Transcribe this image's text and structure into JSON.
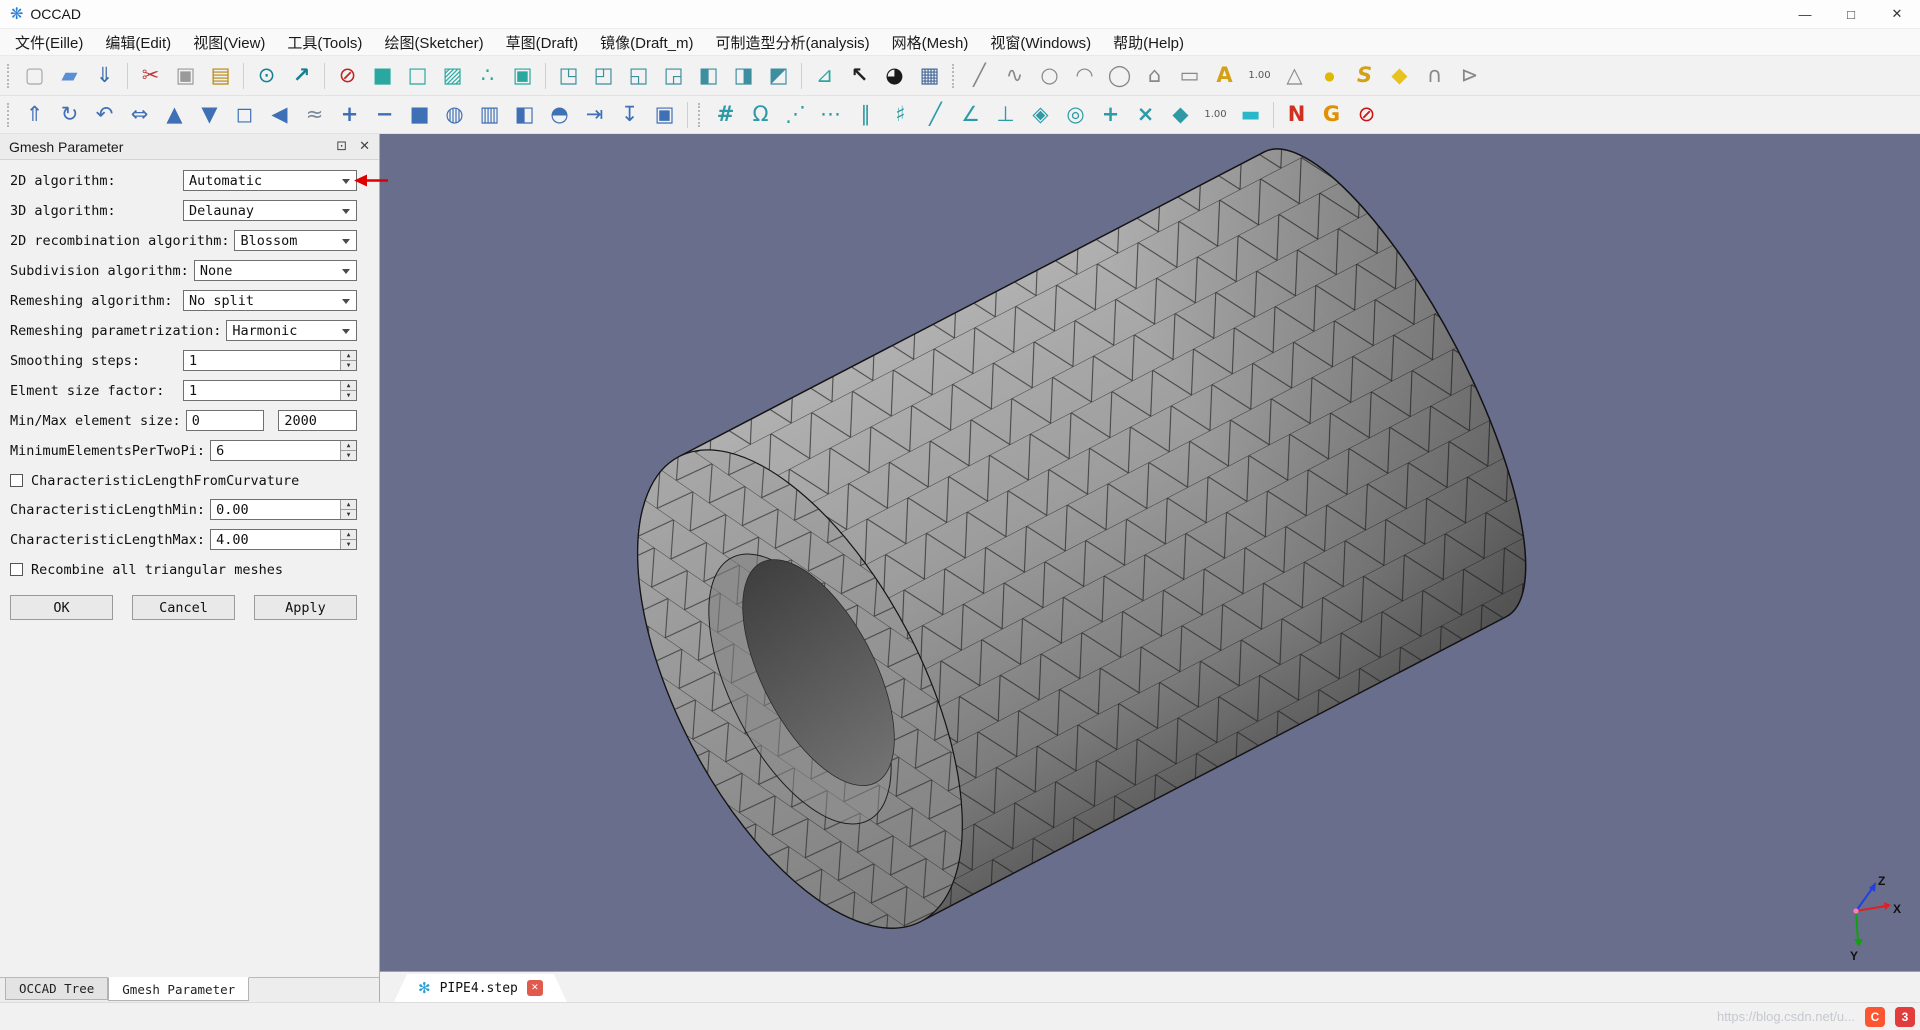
{
  "window": {
    "title": "OCCAD",
    "minimize": "—",
    "maximize": "□",
    "close": "✕"
  },
  "menubar": {
    "items": [
      {
        "name": "menu-file",
        "label": "文件(Eille)"
      },
      {
        "name": "menu-edit",
        "label": "编辑(Edit)"
      },
      {
        "name": "menu-view",
        "label": "视图(View)"
      },
      {
        "name": "menu-tools",
        "label": "工具(Tools)"
      },
      {
        "name": "menu-sketcher",
        "label": "绘图(Sketcher)"
      },
      {
        "name": "menu-draft",
        "label": "草图(Draft)"
      },
      {
        "name": "menu-draft-m",
        "label": "镜像(Draft_m)"
      },
      {
        "name": "menu-analysis",
        "label": "可制造型分析(analysis)"
      },
      {
        "name": "menu-mesh",
        "label": "网格(Mesh)"
      },
      {
        "name": "menu-windows",
        "label": "视窗(Windows)"
      },
      {
        "name": "menu-help",
        "label": "帮助(Help)"
      }
    ]
  },
  "toolbar": {
    "row1": [
      {
        "cls": "tb-handle",
        "ia": "false"
      },
      {
        "cls": "tb-icon",
        "ia": "true",
        "name": "new-file-icon",
        "g": "▢",
        "st": "color:#a8a8a8"
      },
      {
        "cls": "tb-icon",
        "ia": "true",
        "name": "open-folder-icon",
        "g": "▰",
        "st": "color:#5b8fd4"
      },
      {
        "cls": "tb-icon",
        "ia": "true",
        "name": "save-icon",
        "g": "⇓",
        "st": "color:#3a6ea5"
      },
      {
        "cls": "tb-sep",
        "ia": "false"
      },
      {
        "cls": "tb-icon",
        "ia": "true",
        "name": "cut-icon",
        "g": "✂",
        "st": "color:#c43535"
      },
      {
        "cls": "tb-icon",
        "ia": "true",
        "name": "copy-icon",
        "g": "▣",
        "st": "color:#9a9a9a"
      },
      {
        "cls": "tb-icon",
        "ia": "true",
        "name": "paste-icon",
        "g": "▤",
        "st": "color:#b8860b"
      },
      {
        "cls": "tb-sep",
        "ia": "false"
      },
      {
        "cls": "tb-icon",
        "ia": "true",
        "name": "zoom-window-icon",
        "g": "⊙",
        "st": "color:#17808f"
      },
      {
        "cls": "tb-icon",
        "ia": "true",
        "name": "zoom-fit-icon",
        "g": "↗",
        "st": "color:#17808f;font-weight:700"
      },
      {
        "cls": "tb-sep",
        "ia": "false"
      },
      {
        "cls": "tb-icon",
        "ia": "true",
        "name": "display-off-icon",
        "g": "⊘",
        "st": "color:#c22222"
      },
      {
        "cls": "tb-icon",
        "ia": "true",
        "name": "display-shaded-icon",
        "g": "■",
        "st": "color:#2aa8a0"
      },
      {
        "cls": "tb-icon",
        "ia": "true",
        "name": "display-wireframe-icon",
        "g": "□",
        "st": "color:#2aa8a0"
      },
      {
        "cls": "tb-icon",
        "ia": "true",
        "name": "display-hidden-line-icon",
        "g": "▨",
        "st": "color:#2aa8a0"
      },
      {
        "cls": "tb-icon",
        "ia": "true",
        "name": "display-points-icon",
        "g": "∴",
        "st": "color:#2aa8a0"
      },
      {
        "cls": "tb-icon",
        "ia": "true",
        "name": "display-flat-icon",
        "g": "▣",
        "st": "color:#2aa8a0"
      },
      {
        "cls": "tb-sep",
        "ia": "false"
      },
      {
        "cls": "tb-icon",
        "ia": "true",
        "name": "view-axonometric-icon",
        "g": "◳",
        "st": "color:#3d8fa0"
      },
      {
        "cls": "tb-icon",
        "ia": "true",
        "name": "view-front-icon",
        "g": "◰",
        "st": "color:#3d8fa0"
      },
      {
        "cls": "tb-icon",
        "ia": "true",
        "name": "view-top-icon",
        "g": "◱",
        "st": "color:#3d8fa0"
      },
      {
        "cls": "tb-icon",
        "ia": "true",
        "name": "view-right-icon",
        "g": "◲",
        "st": "color:#3d8fa0"
      },
      {
        "cls": "tb-icon",
        "ia": "true",
        "name": "view-rear-icon",
        "g": "◧",
        "st": "color:#3d8fa0"
      },
      {
        "cls": "tb-icon",
        "ia": "true",
        "name": "view-bottom-icon",
        "g": "◨",
        "st": "color:#3d8fa0"
      },
      {
        "cls": "tb-icon",
        "ia": "true",
        "name": "view-left-icon",
        "g": "◩",
        "st": "color:#3d8fa0"
      },
      {
        "cls": "tb-sep",
        "ia": "false"
      },
      {
        "cls": "tb-icon",
        "ia": "true",
        "name": "measure-icon",
        "g": "⊿",
        "st": "color:#2aa8a0"
      },
      {
        "cls": "tb-icon",
        "ia": "true",
        "name": "select-cursor-icon",
        "g": "↖",
        "st": "color:#222222;font-weight:700"
      },
      {
        "cls": "tb-icon",
        "ia": "true",
        "name": "color-palette-icon",
        "g": "◕",
        "st": "color:#1a1a1a"
      },
      {
        "cls": "tb-icon",
        "ia": "true",
        "name": "background-image-icon",
        "g": "▦",
        "st": "color:#44689a"
      },
      {
        "cls": "tb-handle",
        "ia": "false"
      },
      {
        "cls": "tb-icon",
        "ia": "true",
        "name": "sketch-line-icon",
        "g": "╱",
        "st": "color:#888888"
      },
      {
        "cls": "tb-icon",
        "ia": "true",
        "name": "sketch-polyline-icon",
        "g": "∿",
        "st": "color:#888888"
      },
      {
        "cls": "tb-icon",
        "ia": "true",
        "name": "sketch-circle-icon",
        "g": "○",
        "st": "color:#888888"
      },
      {
        "cls": "tb-icon",
        "ia": "true",
        "name": "sketch-arc-icon",
        "g": "◠",
        "st": "color:#888888"
      },
      {
        "cls": "tb-icon",
        "ia": "true",
        "name": "sketch-ellipse-icon",
        "g": "◯",
        "st": "color:#888888"
      },
      {
        "cls": "tb-icon",
        "ia": "true",
        "name": "sketch-polygon-icon",
        "g": "⌂",
        "st": "color:#888888"
      },
      {
        "cls": "tb-icon",
        "ia": "true",
        "name": "sketch-rectangle-icon",
        "g": "▭",
        "st": "color:#888888"
      },
      {
        "cls": "tb-icon",
        "ia": "true",
        "name": "sketch-text-icon",
        "g": "A",
        "st": "color:#d4a017;font-weight:700"
      },
      {
        "cls": "tb-icon",
        "ia": "true",
        "name": "sketch-dimension-icon",
        "g": "1.00",
        "st": "color:#555555;font-size:10px"
      },
      {
        "cls": "tb-icon",
        "ia": "true",
        "name": "sketch-bspline-icon",
        "g": "△",
        "st": "color:#888888"
      },
      {
        "cls": "tb-icon",
        "ia": "true",
        "name": "sketch-point-icon",
        "g": "●",
        "st": "color:#e0b800;font-size:12px"
      },
      {
        "cls": "tb-icon",
        "ia": "true",
        "name": "sketch-spline-icon",
        "g": "S",
        "st": "color:#d4a017;font-weight:700;font-style:italic"
      },
      {
        "cls": "tb-icon",
        "ia": "true",
        "name": "sketch-face-icon",
        "g": "◆",
        "st": "color:#e8c220"
      },
      {
        "cls": "tb-icon",
        "ia": "true",
        "name": "sketch-handles-icon",
        "g": "∩",
        "st": "color:#888888"
      },
      {
        "cls": "tb-icon",
        "ia": "true",
        "name": "sketch-tag-icon",
        "g": "⊳",
        "st": "color:#888888"
      }
    ],
    "row2": [
      {
        "cls": "tb-handle",
        "ia": "false"
      },
      {
        "cls": "tb-icon",
        "ia": "true",
        "name": "pan-move-icon",
        "g": "⇑",
        "st": "color:#3f6fb5"
      },
      {
        "cls": "tb-icon",
        "ia": "true",
        "name": "rotate-icon",
        "g": "↻",
        "st": "color:#3f6fb5"
      },
      {
        "cls": "tb-icon",
        "ia": "true",
        "name": "rotate-back-icon",
        "g": "↶",
        "st": "color:#3f6fb5"
      },
      {
        "cls": "tb-icon",
        "ia": "true",
        "name": "move-horizontal-icon",
        "g": "⇔",
        "st": "color:#3f6fb5"
      },
      {
        "cls": "tb-icon",
        "ia": "true",
        "name": "arrow-up-icon",
        "g": "▲",
        "st": "color:#3f6fb5"
      },
      {
        "cls": "tb-icon",
        "ia": "true",
        "name": "arrow-down-icon",
        "g": "▼",
        "st": "color:#3f6fb5"
      },
      {
        "cls": "tb-icon",
        "ia": "true",
        "name": "select-box-icon",
        "g": "◻",
        "st": "color:#3f6fb5"
      },
      {
        "cls": "tb-icon",
        "ia": "true",
        "name": "cone-view-icon",
        "g": "◀",
        "st": "color:#3f6fb5"
      },
      {
        "cls": "tb-icon",
        "ia": "true",
        "name": "smooth-curve-icon",
        "g": "≈",
        "st": "color:#7a8a9a"
      },
      {
        "cls": "tb-icon",
        "ia": "true",
        "name": "add-icon",
        "g": "+",
        "st": "color:#3f6fb5;font-weight:700"
      },
      {
        "cls": "tb-icon",
        "ia": "true",
        "name": "subtract-icon",
        "g": "−",
        "st": "color:#3f6fb5;font-weight:700"
      },
      {
        "cls": "tb-icon",
        "ia": "true",
        "name": "cube-icon",
        "g": "■",
        "st": "color:#3f6fb5"
      },
      {
        "cls": "tb-icon",
        "ia": "true",
        "name": "sphere-icon",
        "g": "◍",
        "st": "color:#3f6fb5"
      },
      {
        "cls": "tb-icon",
        "ia": "true",
        "name": "grid-panels-icon",
        "g": "▥",
        "st": "color:#3f6fb5"
      },
      {
        "cls": "tb-icon",
        "ia": "true",
        "name": "mirror-icon",
        "g": "◧",
        "st": "color:#3f6fb5"
      },
      {
        "cls": "tb-icon",
        "ia": "true",
        "name": "dome-icon",
        "g": "◓",
        "st": "color:#3f6fb5"
      },
      {
        "cls": "tb-icon",
        "ia": "true",
        "name": "project-icon",
        "g": "⇥",
        "st": "color:#3f6fb5"
      },
      {
        "cls": "tb-icon",
        "ia": "true",
        "name": "drop-pin-icon",
        "g": "↧",
        "st": "color:#3f6fb5"
      },
      {
        "cls": "tb-icon",
        "ia": "true",
        "name": "window-fit-icon",
        "g": "▣",
        "st": "color:#3f6fb5"
      },
      {
        "cls": "tb-sep",
        "ia": "false"
      },
      {
        "cls": "tb-handle",
        "ia": "false"
      },
      {
        "cls": "tb-icon",
        "ia": "true",
        "name": "snap-grid-icon",
        "g": "#",
        "st": "color:#2e9aa5;font-weight:700"
      },
      {
        "cls": "tb-icon",
        "ia": "true",
        "name": "constraint-lock-icon",
        "g": "Ω",
        "st": "color:#2e9aa5"
      },
      {
        "cls": "tb-icon",
        "ia": "true",
        "name": "construction-dots-icon",
        "g": "⋰",
        "st": "color:#2e9aa5"
      },
      {
        "cls": "tb-icon",
        "ia": "true",
        "name": "ellipsis-dots-icon",
        "g": "⋯",
        "st": "color:#2e9aa5"
      },
      {
        "cls": "tb-icon",
        "ia": "true",
        "name": "parallel-icon",
        "g": "∥",
        "st": "color:#2e9aa5"
      },
      {
        "cls": "tb-icon",
        "ia": "true",
        "name": "axes-cross-icon",
        "g": "♯",
        "st": "color:#2e9aa5"
      },
      {
        "cls": "tb-icon",
        "ia": "true",
        "name": "diagonal-line-icon",
        "g": "╱",
        "st": "color:#2e9aa5"
      },
      {
        "cls": "tb-icon",
        "ia": "true",
        "name": "angle-line-icon",
        "g": "∠",
        "st": "color:#2e9aa5"
      },
      {
        "cls": "tb-icon",
        "ia": "true",
        "name": "perpendicular-icon",
        "g": "⊥",
        "st": "color:#2e9aa5"
      },
      {
        "cls": "tb-icon",
        "ia": "true",
        "name": "snap-diamond-icon",
        "g": "◈",
        "st": "color:#2e9aa5"
      },
      {
        "cls": "tb-icon",
        "ia": "true",
        "name": "concentric-icon",
        "g": "◎",
        "st": "color:#2e9aa5"
      },
      {
        "cls": "tb-icon",
        "ia": "true",
        "name": "add-point-icon",
        "g": "+",
        "st": "color:#2e9aa5;font-weight:700"
      },
      {
        "cls": "tb-icon",
        "ia": "true",
        "name": "delete-point-icon",
        "g": "×",
        "st": "color:#2e9aa5;font-weight:700"
      },
      {
        "cls": "tb-icon",
        "ia": "true",
        "name": "solid-box-icon",
        "g": "◆",
        "st": "color:#2e9aa5"
      },
      {
        "cls": "tb-icon",
        "ia": "true",
        "name": "dimension-value-icon",
        "g": "1.00",
        "st": "color:#555555;font-size:10px"
      },
      {
        "cls": "tb-icon",
        "ia": "true",
        "name": "plane-rect-icon",
        "g": "▬",
        "st": "color:#2ab8c8"
      },
      {
        "cls": "tb-sep",
        "ia": "false"
      },
      {
        "cls": "tb-icon",
        "ia": "true",
        "name": "netgen-mesh-icon",
        "g": "N",
        "st": "color:#d03020;font-weight:700"
      },
      {
        "cls": "tb-icon",
        "ia": "true",
        "name": "gmsh-mesh-icon",
        "g": "G",
        "st": "color:#e09000;font-weight:700"
      },
      {
        "cls": "tb-icon",
        "ia": "true",
        "name": "mesh-off-icon",
        "g": "⊘",
        "st": "color:#cc1111"
      }
    ]
  },
  "panel": {
    "title": "Gmesh Parameter",
    "float_btn": "⊡",
    "close_btn": "✕",
    "fields": {
      "algo2d": {
        "label": "2D algorithm:",
        "value": "Automatic"
      },
      "algo3d": {
        "label": "3D algorithm:",
        "value": "Delaunay"
      },
      "recomb": {
        "label": "2D recombination algorithm:",
        "value": "Blossom"
      },
      "subdiv": {
        "label": "Subdivision algorithm:",
        "value": "None"
      },
      "remesh_alg": {
        "label": "Remeshing algorithm:",
        "value": "No split"
      },
      "remesh_param": {
        "label": "Remeshing parametrization:",
        "value": "Harmonic"
      },
      "smoothing": {
        "label": "Smoothing steps:",
        "value": "1"
      },
      "size_factor": {
        "label": "Elment size factor:",
        "value": "1"
      },
      "minmax": {
        "label": "Min/Max element size:",
        "min": "0",
        "max": "2000"
      },
      "min_elems": {
        "label": "MinimumElementsPerTwoPi:",
        "value": "6"
      },
      "curvature_cb": {
        "label": "CharacteristicLengthFromCurvature",
        "checked": false
      },
      "len_min": {
        "label": "CharacteristicLengthMin:",
        "value": "0.00"
      },
      "len_max": {
        "label": "CharacteristicLengthMax:",
        "value": "4.00"
      },
      "recombine_cb": {
        "label": "Recombine all triangular meshes",
        "checked": false
      }
    },
    "buttons": {
      "ok": "OK",
      "cancel": "Cancel",
      "apply": "Apply"
    }
  },
  "bottom_tabs": {
    "items": [
      {
        "label": "OCCAD Tree",
        "active": false
      },
      {
        "label": "Gmesh Parameter",
        "active": true
      }
    ]
  },
  "doc_tab": {
    "label": "PIPE4.step",
    "gear": "✻",
    "close": "✕"
  },
  "viewport": {
    "bg": "#6a6e8d",
    "axis": {
      "x": "X",
      "y": "Y",
      "z": "Z"
    }
  },
  "watermark": {
    "text": "https://blog.csdn.net/u...",
    "logo1": "C",
    "logo2": "3"
  }
}
